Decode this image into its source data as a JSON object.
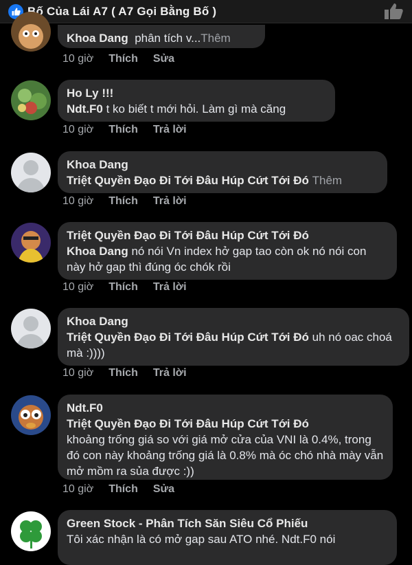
{
  "header": {
    "title": "Bố Của Lái A7  ( A7 Gọi Bằng Bố )",
    "like_icon": "like-icon"
  },
  "comments": [
    {
      "author": "Khoa Dang",
      "text": "phân tích v...",
      "more": "Thêm",
      "time": "10 giờ",
      "like": "Thích",
      "action": "Sửa"
    },
    {
      "author": "Ho Ly !!!",
      "mention": "Ndt.F0",
      "text": " t ko biết t mới hỏi. Làm gì mà căng",
      "time": "10 giờ",
      "like": "Thích",
      "action": "Trả lời"
    },
    {
      "author": "Khoa Dang",
      "mention": "Triệt Quyền Đạo Đi Tới Đâu Húp Cứt Tới Đó",
      "more": "Thêm",
      "time": "10 giờ",
      "like": "Thích",
      "action": "Trả lời"
    },
    {
      "author": "Triệt Quyền Đạo Đi Tới Đâu Húp Cứt Tới Đó",
      "mention": "Khoa Dang",
      "text": " nó nói Vn index hở gap tao còn ok nó nói con này hở gap thì đúng óc chók rồi",
      "time": "10 giờ",
      "like": "Thích",
      "action": "Trả lời"
    },
    {
      "author": "Khoa Dang",
      "mention": "Triệt Quyền Đạo Đi Tới Đâu Húp Cứt Tới Đó",
      "text": " uh nó oac choá mà :))))",
      "time": "10 giờ",
      "like": "Thích",
      "action": "Trả lời"
    },
    {
      "author": "Ndt.F0",
      "mention": "Triệt Quyền Đạo Đi Tới Đâu Húp Cứt Tới Đó",
      "text": "khoảng trống giá so với giá mở cửa của VNI là 0.4%, trong đó con này khoảng trống giá là 0.8% mà óc chó nhà mày vẫn mở mồm ra sủa được :))",
      "time": "10 giờ",
      "like": "Thích",
      "action": "Sửa"
    },
    {
      "author": "Green Stock - Phân Tích Săn Siêu Cổ Phiếu",
      "text": "Tôi xác nhận là có mở gap sau ATO nhé. Ndt.F0 nói"
    }
  ]
}
